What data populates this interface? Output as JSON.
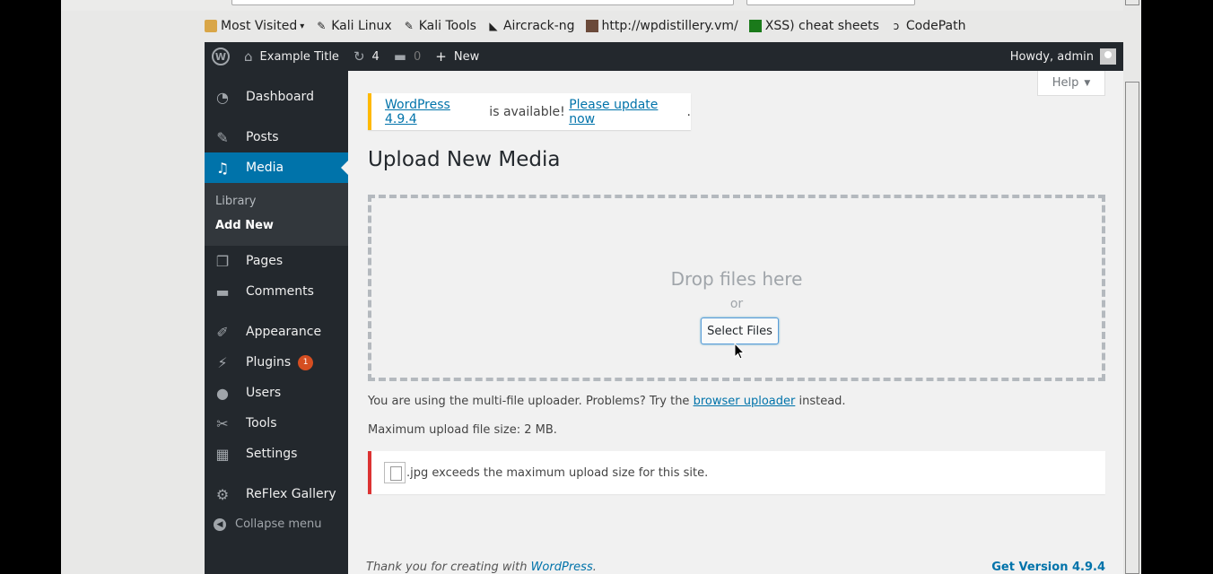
{
  "bookmarks": [
    {
      "label": "Most Visited",
      "icon": "folder-icon",
      "dropdown": "▾"
    },
    {
      "label": "Kali Linux",
      "icon": "kali-dragon-icon"
    },
    {
      "label": "Kali Tools",
      "icon": "kali-dragon-icon"
    },
    {
      "label": "Aircrack-ng",
      "icon": "aircrack-icon"
    },
    {
      "label": "http://wpdistillery.vm/",
      "icon": "wpdistillery-icon"
    },
    {
      "label": "XSS) cheat sheets",
      "icon": "xss-icon"
    },
    {
      "label": "CodePath",
      "icon": "codepath-icon"
    }
  ],
  "adminbar": {
    "site_title": "Example Title",
    "updates_count": "4",
    "comments_count": "0",
    "new_label": "New",
    "howdy": "Howdy, admin"
  },
  "sidebar": {
    "items": [
      {
        "label": "Dashboard",
        "icon": "dashboard-icon"
      },
      {
        "label": "Posts",
        "icon": "pin-icon"
      },
      {
        "label": "Media",
        "icon": "media-icon"
      },
      {
        "label": "Pages",
        "icon": "pages-icon"
      },
      {
        "label": "Comments",
        "icon": "comment-icon"
      },
      {
        "label": "Appearance",
        "icon": "brush-icon"
      },
      {
        "label": "Plugins",
        "icon": "plug-icon",
        "badge": "1"
      },
      {
        "label": "Users",
        "icon": "user-icon"
      },
      {
        "label": "Tools",
        "icon": "wrench-icon"
      },
      {
        "label": "Settings",
        "icon": "settings-icon"
      },
      {
        "label": "ReFlex Gallery",
        "icon": "gear-icon"
      }
    ],
    "submenu": {
      "library": "Library",
      "add_new": "Add New"
    },
    "collapse": "Collapse menu"
  },
  "main": {
    "help": "Help",
    "notice": {
      "link1": "WordPress 4.9.4",
      "middle": " is available! ",
      "link2": "Please update now",
      "end": "."
    },
    "title": "Upload New Media",
    "drop_text": "Drop files here",
    "or_text": "or",
    "select_button": "Select Files",
    "info1_prefix": "You are using the multi-file uploader. Problems? Try the ",
    "info1_link": "browser uploader",
    "info1_suffix": " instead.",
    "info2": "Maximum upload file size: 2 MB.",
    "error_text": ".jpg exceeds the maximum upload size for this site.",
    "footer_prefix": "Thank you for creating with ",
    "footer_link": "WordPress",
    "footer_suffix": ".",
    "footer_version": "Get Version 4.9.4"
  },
  "colors": {
    "admin_dark": "#23282d",
    "accent": "#0073aa",
    "warning": "#ffb900",
    "error": "#dc3232",
    "badge": "#d54e21"
  }
}
